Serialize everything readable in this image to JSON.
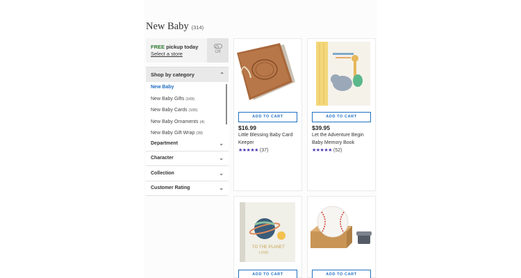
{
  "header": {
    "title": "New Baby",
    "count": "(314)"
  },
  "pickup": {
    "free": "FREE",
    "label": "pickup today",
    "link": "Select a store",
    "toggle": "Off"
  },
  "categories": {
    "header": "Shop by category",
    "items": [
      {
        "label": "New Baby",
        "count": ""
      },
      {
        "label": "New Baby Gifts",
        "count": "(169)"
      },
      {
        "label": "New Baby Cards",
        "count": "(100)"
      },
      {
        "label": "New Baby Ornaments",
        "count": "(4)"
      },
      {
        "label": "New Baby Gift Wrap",
        "count": "(39)"
      }
    ]
  },
  "facets": [
    "Department",
    "Character",
    "Collection",
    "Customer Rating"
  ],
  "products": [
    {
      "button": "ADD TO CART",
      "price": "$16.99",
      "name": "Little Blessing Baby Card Keeper",
      "stars": "★★★★★",
      "reviews": "(37)"
    },
    {
      "button": "ADD TO CART",
      "price": "$39.95",
      "name": "Let the Adventure Begin Baby Memory Book",
      "stars": "★★★★★",
      "reviews": "(52)"
    },
    {
      "button": "ADD TO CART"
    },
    {
      "button": "ADD TO CART"
    }
  ],
  "colors": {
    "free_green": "#2d7a2d",
    "link_blue": "#1f6fc2",
    "star_purple": "#4b3bb0"
  }
}
